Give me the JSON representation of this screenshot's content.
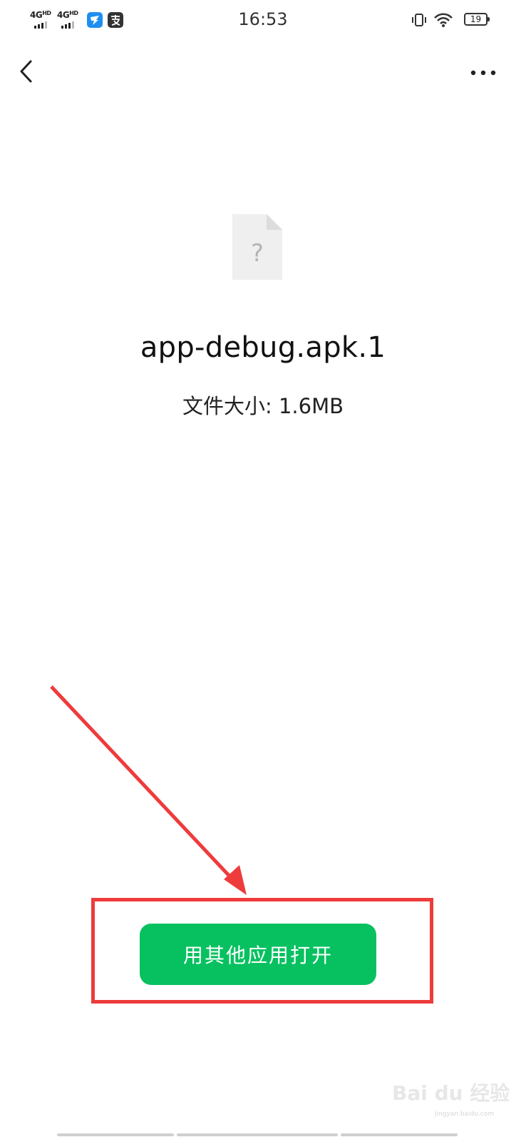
{
  "status_bar": {
    "network_1": "4G",
    "network_1_sup": "HD",
    "network_2": "4G",
    "network_2_sup": "HD",
    "time": "16:53",
    "battery": "19"
  },
  "header": {
    "back_icon": "chevron-left-icon",
    "more_icon": "more-horizontal-icon"
  },
  "file": {
    "icon": "unknown-file-icon",
    "icon_glyph": "?",
    "name": "app-debug.apk.1",
    "size_label": "文件大小: 1.6MB"
  },
  "actions": {
    "open_with_other_app": "用其他应用打开"
  },
  "watermark": {
    "text": "Bai du 经验",
    "sub": "jingyan.baidu.com"
  },
  "colors": {
    "primary_button": "#07c160",
    "annotation": "#ee3b3b"
  }
}
